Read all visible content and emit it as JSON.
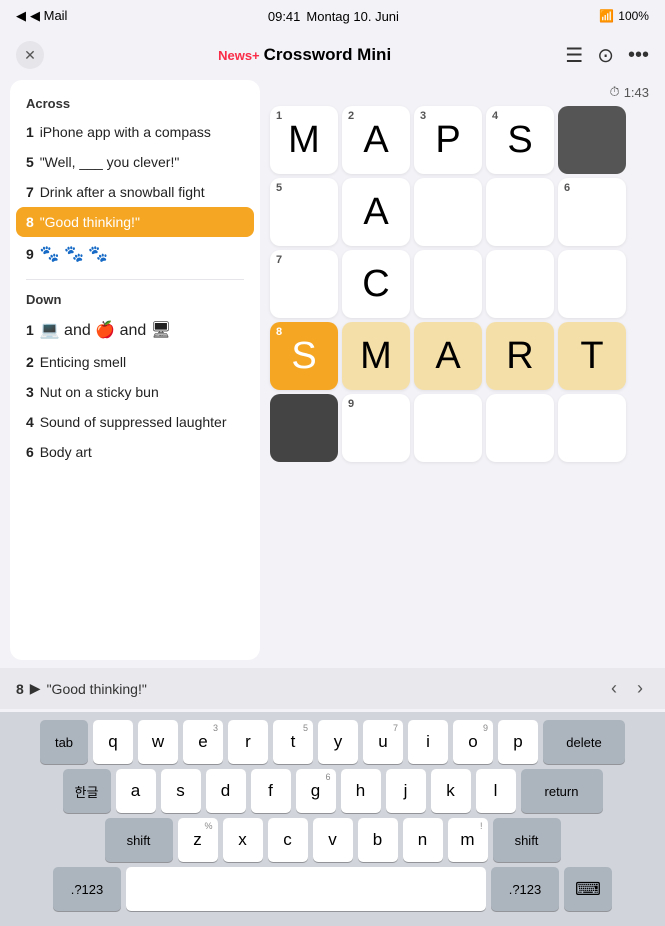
{
  "statusBar": {
    "left": "◀ Mail",
    "time": "09:41",
    "date": "Montag 10. Juni",
    "dots": "• • •",
    "wifi": "WiFi",
    "battery": "100%"
  },
  "header": {
    "title": "Crossword Mini",
    "newsPlus": "News+",
    "closeLabel": "✕"
  },
  "timer": {
    "icon": "⏱",
    "value": "1:43"
  },
  "clues": {
    "acrossHeader": "Across",
    "acrossItems": [
      {
        "num": "1",
        "text": "iPhone app with a compass"
      },
      {
        "num": "5",
        "text": "\"Well, ___ you clever!\""
      },
      {
        "num": "7",
        "text": "Drink after a snowball fight"
      },
      {
        "num": "8",
        "text": "\"Good thinking!\"",
        "active": true
      },
      {
        "num": "9",
        "text": "🐾 🐾 🐾"
      }
    ],
    "downHeader": "Down",
    "downItems": [
      {
        "num": "1",
        "text": "💻 and 🍎 and 🖥"
      },
      {
        "num": "2",
        "text": "Enticing smell"
      },
      {
        "num": "3",
        "text": "Nut on a sticky bun"
      },
      {
        "num": "4",
        "text": "Sound of suppressed laughter"
      },
      {
        "num": "6",
        "text": "Body art"
      }
    ]
  },
  "grid": {
    "cells": [
      {
        "id": "r0c0",
        "num": "1",
        "letter": "M",
        "state": "normal"
      },
      {
        "id": "r0c1",
        "num": "2",
        "letter": "A",
        "state": "normal"
      },
      {
        "id": "r0c2",
        "num": "3",
        "letter": "P",
        "state": "normal"
      },
      {
        "id": "r0c3",
        "num": "4",
        "letter": "S",
        "state": "normal"
      },
      {
        "id": "r0c4",
        "num": "",
        "letter": "",
        "state": "black"
      },
      {
        "id": "r1c0",
        "num": "5",
        "letter": "",
        "state": "normal"
      },
      {
        "id": "r1c1",
        "num": "",
        "letter": "A",
        "state": "normal"
      },
      {
        "id": "r1c2",
        "num": "",
        "letter": "",
        "state": "normal"
      },
      {
        "id": "r1c3",
        "num": "",
        "letter": "",
        "state": "normal"
      },
      {
        "id": "r1c4",
        "num": "6",
        "letter": "",
        "state": "normal"
      },
      {
        "id": "r2c0",
        "num": "7",
        "letter": "",
        "state": "normal"
      },
      {
        "id": "r2c1",
        "num": "",
        "letter": "C",
        "state": "normal"
      },
      {
        "id": "r2c2",
        "num": "",
        "letter": "",
        "state": "normal"
      },
      {
        "id": "r2c3",
        "num": "",
        "letter": "",
        "state": "normal"
      },
      {
        "id": "r2c4",
        "num": "",
        "letter": "",
        "state": "normal"
      },
      {
        "id": "r3c0",
        "num": "8",
        "letter": "S",
        "state": "active"
      },
      {
        "id": "r3c1",
        "num": "",
        "letter": "M",
        "state": "highlighted"
      },
      {
        "id": "r3c2",
        "num": "",
        "letter": "A",
        "state": "highlighted"
      },
      {
        "id": "r3c3",
        "num": "",
        "letter": "R",
        "state": "highlighted"
      },
      {
        "id": "r3c4",
        "num": "",
        "letter": "T",
        "state": "highlighted"
      },
      {
        "id": "r4c0",
        "num": "",
        "letter": "",
        "state": "dark-black"
      },
      {
        "id": "r4c1",
        "num": "9",
        "letter": "",
        "state": "normal"
      },
      {
        "id": "r4c2",
        "num": "",
        "letter": "",
        "state": "normal"
      },
      {
        "id": "r4c3",
        "num": "",
        "letter": "",
        "state": "normal"
      },
      {
        "id": "r4c4",
        "num": "",
        "letter": "",
        "state": "normal"
      }
    ]
  },
  "bottomClue": {
    "num": "8",
    "emoji": "▶",
    "text": "\"Good thinking!\""
  },
  "keyboard": {
    "row1": [
      "q",
      "w",
      "e",
      "r",
      "t",
      "y",
      "u",
      "i",
      "o",
      "p"
    ],
    "row1nums": [
      "",
      "",
      "3",
      "",
      "5",
      "",
      "7",
      "",
      "9",
      ""
    ],
    "row2": [
      "a",
      "s",
      "d",
      "f",
      "g",
      "h",
      "j",
      "k",
      "l"
    ],
    "row2nums": [
      "",
      "",
      "",
      "",
      "6",
      "",
      "",
      "",
      ""
    ],
    "row3": [
      "z",
      "x",
      "c",
      "v",
      "b",
      "n",
      "m"
    ],
    "row3nums": [
      "%",
      "",
      "",
      "",
      "",
      "",
      "!"
    ],
    "specialLeft": "tab",
    "specialLeft2": "한글",
    "shift": "shift",
    "delete": "delete",
    "return": "return",
    "spacebarLabel": "",
    "numbers": ".?123",
    "emojiKey": "⌨"
  }
}
